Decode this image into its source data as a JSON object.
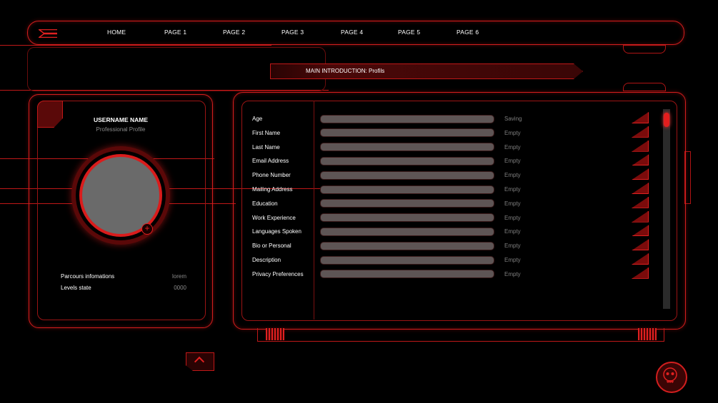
{
  "nav": {
    "items": [
      "HOME",
      "PAGE 1",
      "PAGE 2",
      "PAGE 3",
      "PAGE 4",
      "PAGE 5",
      "PAGE 6"
    ]
  },
  "intro": {
    "title": "MAIN INTRODUCTION: Profils"
  },
  "profile": {
    "username": "USERNAME NAME",
    "role": "Professional Profile",
    "info": [
      {
        "label": "Parcours infomations",
        "value": "lorem"
      },
      {
        "label": "Levels state",
        "value": "0000"
      }
    ]
  },
  "fields": [
    {
      "label": "Age",
      "status": "Saving"
    },
    {
      "label": "First Name",
      "status": "Empty"
    },
    {
      "label": "Last Name",
      "status": "Empty"
    },
    {
      "label": "Email Address",
      "status": "Empty"
    },
    {
      "label": "Phone Number",
      "status": "Empty"
    },
    {
      "label": "Mailing Address",
      "status": "Empty"
    },
    {
      "label": "Education",
      "status": "Empty"
    },
    {
      "label": "Work Experience",
      "status": "Empty"
    },
    {
      "label": "Languages Spoken",
      "status": "Empty"
    },
    {
      "label": "Bio or Personal",
      "status": "Empty"
    },
    {
      "label": "Description",
      "status": "Empty"
    },
    {
      "label": "Privacy Preferences",
      "status": "Empty"
    }
  ],
  "icons": {
    "logo": "menu-logo-icon",
    "add_photo": "plus-icon",
    "row_action": "corner-arrow-icon",
    "scroll_up": "chevron-up-icon",
    "assistant": "skull-icon"
  },
  "colors": {
    "accent": "#d21e1e",
    "bar": "#5e5555",
    "muted": "#7f7f7f"
  }
}
